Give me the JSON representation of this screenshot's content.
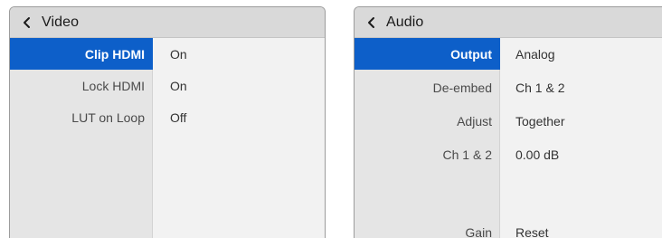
{
  "video_panel": {
    "title": "Video",
    "rows": [
      {
        "label": "Clip HDMI",
        "value": "On",
        "selected": true
      },
      {
        "label": "Lock HDMI",
        "value": "On",
        "selected": false
      },
      {
        "label": "LUT on Loop",
        "value": "Off",
        "selected": false
      }
    ]
  },
  "audio_panel": {
    "title": "Audio",
    "rows": [
      {
        "label": "Output",
        "value": "Analog",
        "selected": true
      },
      {
        "label": "De-embed",
        "value": "Ch 1 & 2",
        "selected": false
      },
      {
        "label": "Adjust",
        "value": "Together",
        "selected": false
      },
      {
        "label": "Ch 1 & 2",
        "value": "0.00 dB",
        "selected": false
      },
      {
        "label": "Gain",
        "value": "Reset",
        "selected": false
      }
    ]
  },
  "icons": {
    "back": "chevron-left-icon"
  },
  "colors": {
    "selected_row": "#0d5fc9",
    "header_bg": "#d9d9d9",
    "label_column_bg": "#e5e5e5",
    "value_column_bg": "#f2f2f2"
  }
}
